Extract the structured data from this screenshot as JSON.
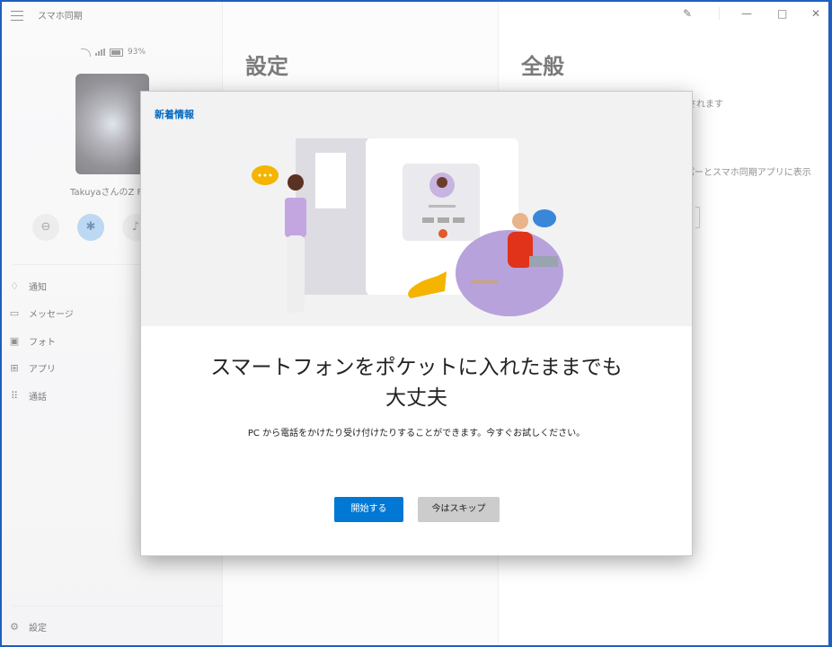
{
  "window": {
    "app_title": "スマホ同期",
    "pen_icon": "pen-icon",
    "minimize_icon": "minimize-icon",
    "maximize_icon": "maximize-icon",
    "close_icon": "close-icon"
  },
  "sidebar": {
    "battery": "93%",
    "device_name": "TakuyaさんのZ Fo",
    "items": [
      {
        "label": "通知",
        "icon": "bell-icon"
      },
      {
        "label": "メッセージ",
        "icon": "message-icon"
      },
      {
        "label": "フォト",
        "icon": "photo-icon"
      },
      {
        "label": "アプリ",
        "icon": "apps-icon"
      },
      {
        "label": "通話",
        "icon": "dialpad-icon"
      }
    ],
    "settings_label": "設定"
  },
  "settings": {
    "title": "設定"
  },
  "general": {
    "title": "全般",
    "text1": "されます",
    "text2": "パーとスマホ同期アプリに表示"
  },
  "dialog": {
    "label": "新着情報",
    "title": "スマートフォンをポケットに入れたままでも大丈夫",
    "body": "PC から電話をかけたり受け付けたりすることができます。今すぐお試しください。",
    "primary": "開始する",
    "secondary": "今はスキップ"
  },
  "colors": {
    "accent": "#0078d4",
    "label": "#0067c0",
    "avatar_purple": "#b8a4d8"
  }
}
